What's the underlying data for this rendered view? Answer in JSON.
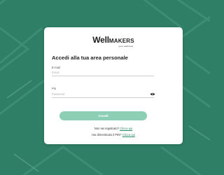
{
  "colors": {
    "background": "#2f7f66",
    "accent": "#2e8a6c",
    "button": "#8ccfb5"
  },
  "logo": {
    "main_prefix": "Well",
    "main_suffix": "MAKERS",
    "tagline": "your wellness"
  },
  "form": {
    "title": "Accedi alla tua area personale",
    "email": {
      "label": "E-mail",
      "placeholder": "Email"
    },
    "password": {
      "label": "Pin",
      "placeholder": "Password",
      "toggle_icon": "eye-icon"
    },
    "submit_label": "Accedi"
  },
  "links": {
    "register_prefix": "Non sei registrato?",
    "register_link": "Clicca qui",
    "forgot_prefix": "Hai dimenticato il PIN?",
    "forgot_link": "Clicca qui"
  }
}
